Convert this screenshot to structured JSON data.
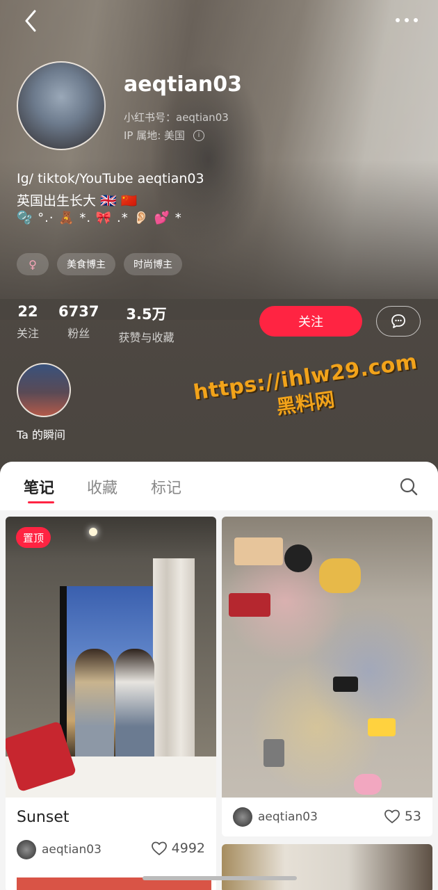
{
  "profile": {
    "username": "aeqtian03",
    "red_id_line": "小红书号：aeqtian03",
    "ip_line": "IP 属地: 美国",
    "bio": [
      "Ig/ tiktok/YouTube aeqtian03",
      "英国出生长大 🇬🇧 🇨🇳",
      "🫧 °.· 🧸 *. 🎀 .* 👂🏻 💕 *"
    ],
    "tags": [
      "♀",
      "美食博主",
      "时尚博主"
    ],
    "stats": [
      {
        "num": "22",
        "label": "关注"
      },
      {
        "num": "6737",
        "label": "粉丝"
      },
      {
        "num": "3.5万",
        "label": "获赞与收藏"
      }
    ],
    "follow_label": "关注",
    "moment_label": "Ta 的瞬间"
  },
  "watermark": {
    "url": "https://ihlw29.com",
    "sub": "黑料网"
  },
  "tabs": [
    "笔记",
    "收藏",
    "标记"
  ],
  "notes": [
    {
      "badge": "置顶",
      "title": "Sunset",
      "user": "aeqtian03",
      "likes": "4992"
    },
    {
      "title": "",
      "user": "aeqtian03",
      "likes": "53"
    }
  ],
  "icons": {
    "back": "chevron-left-icon",
    "more": "more-horizontal-icon",
    "message": "chat-bubble-icon",
    "search": "search-icon",
    "heart": "heart-icon"
  },
  "colors": {
    "accent": "#ff2442",
    "header_bg": "#4e4842"
  }
}
